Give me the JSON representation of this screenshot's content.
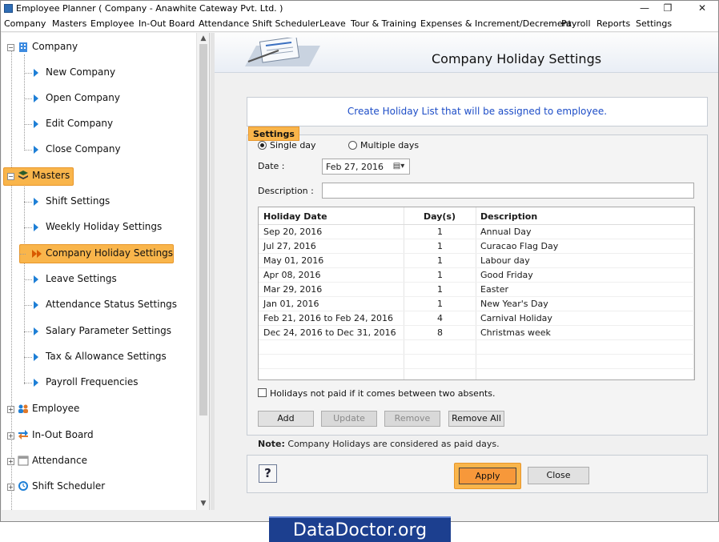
{
  "window": {
    "title": "Employee Planner ( Company - Anawhite Cateway Pvt. Ltd. )",
    "minimize": "—",
    "restore": "❐",
    "close": "✕"
  },
  "menu": [
    "Company",
    "Masters",
    "Employee",
    "In-Out Board",
    "Attendance",
    "Shift Scheduler",
    "Leave",
    "Tour & Training",
    "Expenses & Increment/Decrement",
    "Payroll",
    "Reports",
    "Settings"
  ],
  "tree": {
    "company": {
      "label": "Company",
      "children": [
        "New Company",
        "Open Company",
        "Edit Company",
        "Close Company"
      ]
    },
    "masters": {
      "label": "Masters",
      "children": [
        "Shift Settings",
        "Weekly Holiday Settings",
        "Company Holiday Settings",
        "Leave Settings",
        "Attendance Status Settings",
        "Salary Parameter Settings",
        "Tax & Allowance Settings",
        "Payroll Frequencies"
      ],
      "selected_child": "Company Holiday Settings"
    },
    "others": [
      "Employee",
      "In-Out Board",
      "Attendance",
      "Shift Scheduler"
    ]
  },
  "page": {
    "title": "Company Holiday Settings",
    "info": "Create Holiday List that will be assigned to employee.",
    "group_label": "Settings",
    "single_day": "Single day",
    "multiple_days": "Multiple days",
    "selected_mode": "Single day",
    "date_label": "Date :",
    "date_value": "Feb  27, 2016",
    "date_picker_icon": "calendar-dropdown",
    "description_label": "Description :",
    "description_value": ""
  },
  "grid": {
    "headers": [
      "Holiday Date",
      "Day(s)",
      "Description"
    ],
    "rows": [
      [
        "Sep 20, 2016",
        "1",
        "Annual Day"
      ],
      [
        "Jul 27, 2016",
        "1",
        "Curacao Flag Day"
      ],
      [
        "May 01, 2016",
        "1",
        "Labour day"
      ],
      [
        "Apr 08, 2016",
        "1",
        "Good Friday"
      ],
      [
        "Mar 29, 2016",
        "1",
        "Easter"
      ],
      [
        "Jan 01, 2016",
        "1",
        "New Year's Day"
      ],
      [
        "Feb 21, 2016 to Feb 24, 2016",
        "4",
        "Carnival Holiday"
      ],
      [
        "Dec 24, 2016 to Dec 31, 2016",
        "8",
        "Christmas week"
      ]
    ]
  },
  "options": {
    "not_paid_checkbox": "Holidays not paid if it comes between two absents.",
    "not_paid_checked": false
  },
  "buttons": {
    "add": "Add",
    "update": "Update",
    "remove": "Remove",
    "remove_all": "Remove All",
    "help": "?",
    "apply": "Apply",
    "close": "Close"
  },
  "note": {
    "prefix": "Note:",
    "text": "Company Holidays are considered as paid days."
  },
  "watermark": "DataDoctor.org",
  "colors": {
    "highlight": "#f9b54b",
    "apply": "#f7983a",
    "info_text": "#1d4dc7",
    "watermark_bg": "#1c3f8f"
  }
}
